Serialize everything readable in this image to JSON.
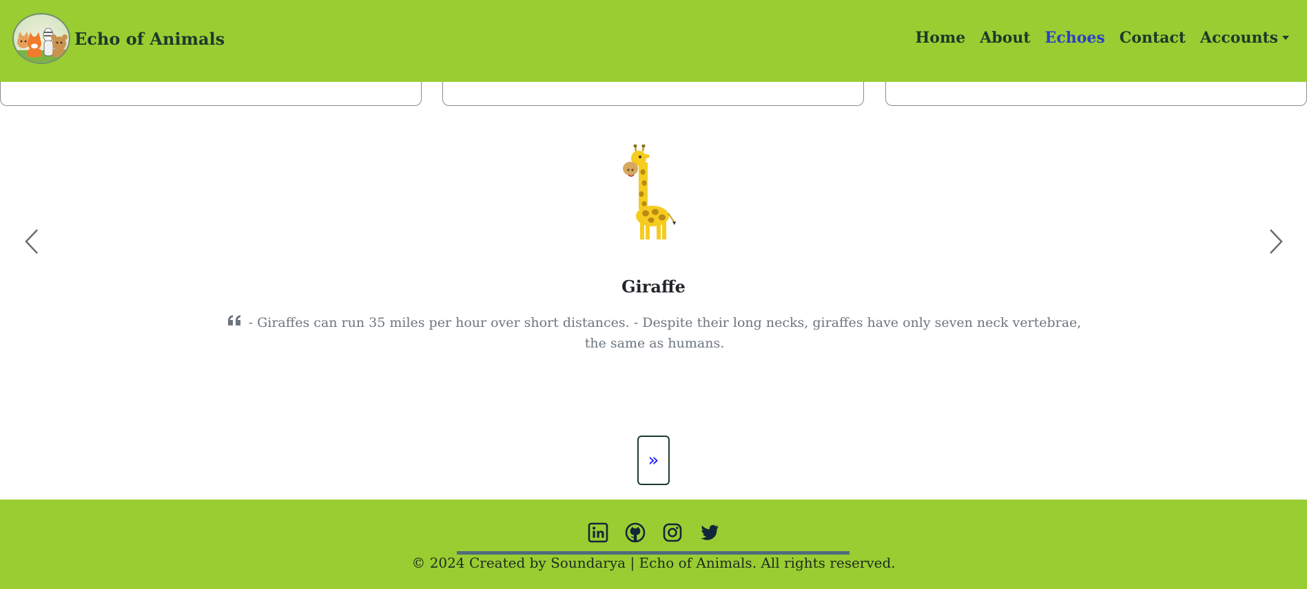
{
  "header": {
    "brand_name": "Echo of Animals",
    "nav": [
      {
        "label": "Home",
        "active": false
      },
      {
        "label": "About",
        "active": false
      },
      {
        "label": "Echoes",
        "active": true
      },
      {
        "label": "Contact",
        "active": false
      },
      {
        "label": "Accounts",
        "active": false,
        "dropdown": true
      }
    ]
  },
  "carousel": {
    "animal_name": "Giraffe",
    "quote": "- Giraffes can run 35 miles per hour over short distances. - Despite their long necks, giraffes have only seven neck vertebrae, the same as humans.",
    "prev_icon": "chevron-left-icon",
    "next_icon": "chevron-right-icon"
  },
  "pagination": {
    "next_label": "»"
  },
  "footer": {
    "social": [
      "linkedin-icon",
      "github-icon",
      "instagram-icon",
      "twitter-icon"
    ],
    "copyright": "© 2024 Created by Soundarya | Echo of Animals. All rights reserved."
  },
  "colors": {
    "header_bg": "#9acd32",
    "footer_bg": "#9acd32",
    "active_link": "#2c3ec9",
    "text_dark": "#1b3a2a",
    "quote_text": "#6c757d"
  }
}
